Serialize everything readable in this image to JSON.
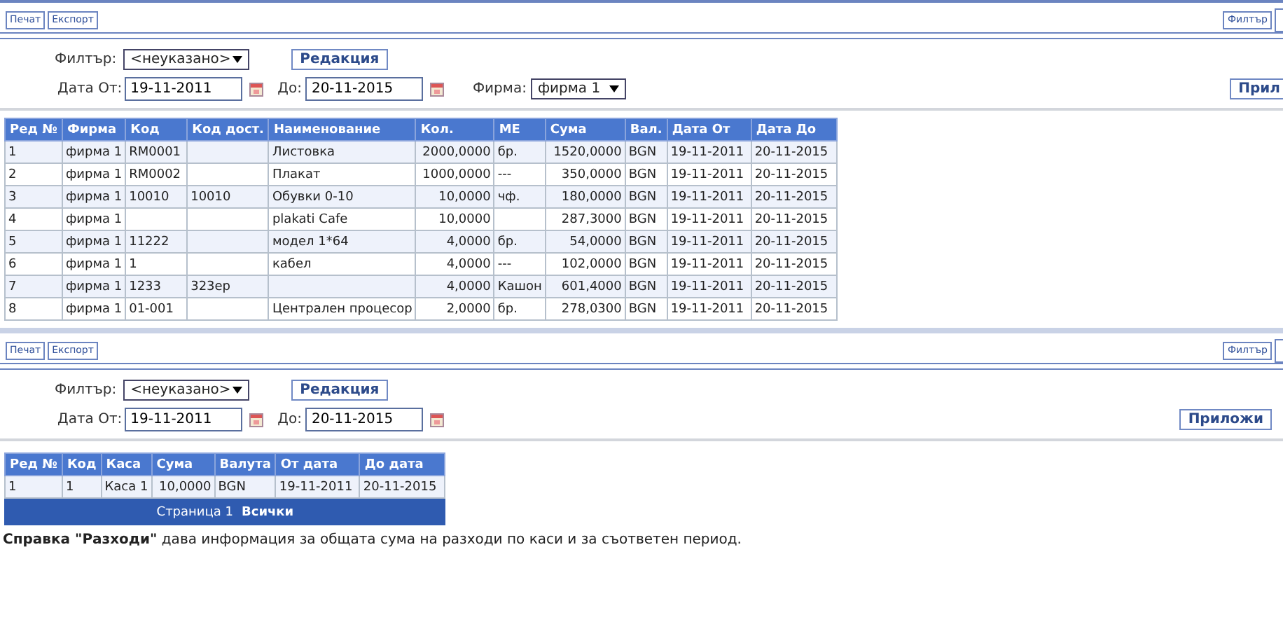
{
  "panels": [
    {
      "toolbar": {
        "left": [
          "Печат",
          "Експорт"
        ],
        "right": [
          "Филтър"
        ]
      },
      "filter": {
        "label": "Филтър:",
        "value": "<неуказано>",
        "edit_button": "Редакция"
      },
      "dates": {
        "from_label": "Дата От:",
        "from": "19-11-2011",
        "to_label": "До:",
        "to": "20-11-2015"
      },
      "firm": {
        "label": "Фирма:",
        "value": "фирма 1"
      },
      "apply_button": "Прил",
      "table": {
        "columns": [
          "Ред №",
          "Фирма",
          "Код",
          "Код дост.",
          "Наименование",
          "Кол.",
          "МЕ",
          "Сума",
          "Вал.",
          "Дата От",
          "Дата До"
        ],
        "rows": [
          [
            "1",
            "фирма 1",
            "RM0001",
            "",
            "Листовка",
            "2000,0000",
            "бр.",
            "1520,0000",
            "BGN",
            "19-11-2011",
            "20-11-2015"
          ],
          [
            "2",
            "фирма 1",
            "RM0002",
            "",
            "Плакат",
            "1000,0000",
            "---",
            "350,0000",
            "BGN",
            "19-11-2011",
            "20-11-2015"
          ],
          [
            "3",
            "фирма 1",
            "10010",
            "10010",
            "Обувки 0-10",
            "10,0000",
            "чф.",
            "180,0000",
            "BGN",
            "19-11-2011",
            "20-11-2015"
          ],
          [
            "4",
            "фирма 1",
            "",
            "",
            "plakati Cafe",
            "10,0000",
            "",
            "287,3000",
            "BGN",
            "19-11-2011",
            "20-11-2015"
          ],
          [
            "5",
            "фирма 1",
            "11222",
            "",
            "модел 1*64",
            "4,0000",
            "бр.",
            "54,0000",
            "BGN",
            "19-11-2011",
            "20-11-2015"
          ],
          [
            "6",
            "фирма 1",
            "1",
            "",
            "кабел",
            "4,0000",
            "---",
            "102,0000",
            "BGN",
            "19-11-2011",
            "20-11-2015"
          ],
          [
            "7",
            "фирма 1",
            "1233",
            "323ер",
            "",
            "4,0000",
            "Кашон",
            "601,4000",
            "BGN",
            "19-11-2011",
            "20-11-2015"
          ],
          [
            "8",
            "фирма 1",
            "01-001",
            "",
            "Централен процесор",
            "2,0000",
            "бр.",
            "278,0300",
            "BGN",
            "19-11-2011",
            "20-11-2015"
          ]
        ]
      }
    },
    {
      "toolbar": {
        "left": [
          "Печат",
          "Експорт"
        ],
        "right": [
          "Филтър"
        ]
      },
      "filter": {
        "label": "Филтър:",
        "value": "<неуказано>",
        "edit_button": "Редакция"
      },
      "dates": {
        "from_label": "Дата От:",
        "from": "19-11-2011",
        "to_label": "До:",
        "to": "20-11-2015"
      },
      "apply_button": "Приложи",
      "table": {
        "columns": [
          "Ред №",
          "Код",
          "Каса",
          "Сума",
          "Валута",
          "От дата",
          "До дата"
        ],
        "rows": [
          [
            "1",
            "1",
            "Каса 1",
            "10,0000",
            "BGN",
            "19-11-2011",
            "20-11-2015"
          ]
        ]
      },
      "pager": {
        "page": "Страница 1",
        "all": "Всички"
      }
    }
  ],
  "note": "**Справка \"Разходи\"** дава информация за общата сума на разходи по каси и за съответен период."
}
